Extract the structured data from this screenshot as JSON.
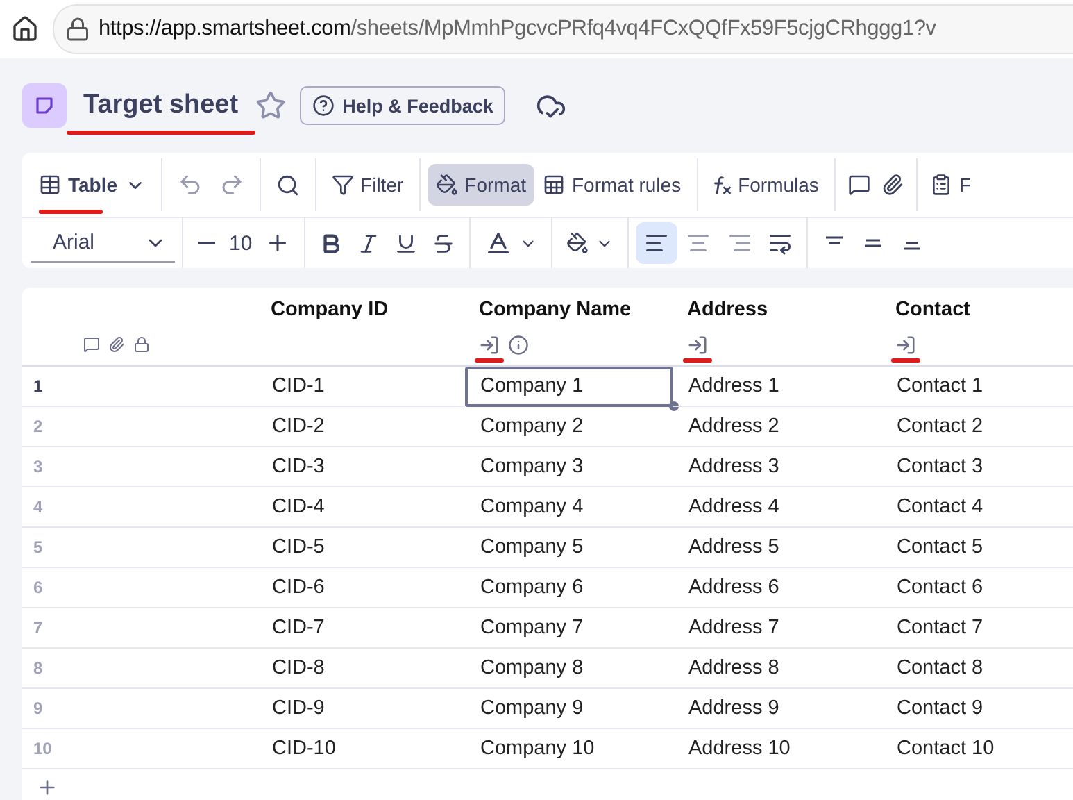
{
  "browser": {
    "url_host": "https://app.smartsheet.com",
    "url_path": "/sheets/MpMmhPgcvcPRfq4vq4FCxQQfFx59F5cjgCRhggg1?v"
  },
  "sheet": {
    "title": "Target sheet",
    "annotated": true,
    "starred": false,
    "help_button": "Help & Feedback"
  },
  "toolbar": {
    "view": {
      "label": "Table",
      "annotated": true
    },
    "filter": "Filter",
    "format": {
      "label": "Format",
      "selected": true
    },
    "format_rules": "Format rules",
    "formulas": "Formulas",
    "cut_off_label": "F"
  },
  "format_bar": {
    "font": "Arial",
    "size": "10",
    "alignment": [
      {
        "kind": "left",
        "selected": true
      },
      {
        "kind": "center",
        "selected": false
      },
      {
        "kind": "right",
        "selected": false
      }
    ]
  },
  "table": {
    "columns": [
      {
        "label": "Company ID",
        "import_icon": false,
        "info_icon": false,
        "annotated": false
      },
      {
        "label": "Company Name",
        "import_icon": true,
        "info_icon": true,
        "annotated": true
      },
      {
        "label": "Address",
        "import_icon": true,
        "info_icon": false,
        "annotated": true
      },
      {
        "label": "Contact",
        "import_icon": true,
        "info_icon": false,
        "annotated": true
      }
    ],
    "rows": [
      {
        "number": "1",
        "selected": true,
        "cells": [
          {
            "text": "CID-1",
            "focused": false
          },
          {
            "text": "Company 1",
            "focused": true
          },
          {
            "text": "Address 1",
            "focused": false
          },
          {
            "text": "Contact 1",
            "focused": false
          }
        ]
      },
      {
        "number": "2",
        "selected": false,
        "cells": [
          {
            "text": "CID-2",
            "focused": false
          },
          {
            "text": "Company 2",
            "focused": false
          },
          {
            "text": "Address 2",
            "focused": false
          },
          {
            "text": "Contact 2",
            "focused": false
          }
        ]
      },
      {
        "number": "3",
        "selected": false,
        "cells": [
          {
            "text": "CID-3",
            "focused": false
          },
          {
            "text": "Company 3",
            "focused": false
          },
          {
            "text": "Address 3",
            "focused": false
          },
          {
            "text": "Contact 3",
            "focused": false
          }
        ]
      },
      {
        "number": "4",
        "selected": false,
        "cells": [
          {
            "text": "CID-4",
            "focused": false
          },
          {
            "text": "Company 4",
            "focused": false
          },
          {
            "text": "Address 4",
            "focused": false
          },
          {
            "text": "Contact 4",
            "focused": false
          }
        ]
      },
      {
        "number": "5",
        "selected": false,
        "cells": [
          {
            "text": "CID-5",
            "focused": false
          },
          {
            "text": "Company 5",
            "focused": false
          },
          {
            "text": "Address 5",
            "focused": false
          },
          {
            "text": "Contact 5",
            "focused": false
          }
        ]
      },
      {
        "number": "6",
        "selected": false,
        "cells": [
          {
            "text": "CID-6",
            "focused": false
          },
          {
            "text": "Company 6",
            "focused": false
          },
          {
            "text": "Address 6",
            "focused": false
          },
          {
            "text": "Contact 6",
            "focused": false
          }
        ]
      },
      {
        "number": "7",
        "selected": false,
        "cells": [
          {
            "text": "CID-7",
            "focused": false
          },
          {
            "text": "Company 7",
            "focused": false
          },
          {
            "text": "Address 7",
            "focused": false
          },
          {
            "text": "Contact 7",
            "focused": false
          }
        ]
      },
      {
        "number": "8",
        "selected": false,
        "cells": [
          {
            "text": "CID-8",
            "focused": false
          },
          {
            "text": "Company 8",
            "focused": false
          },
          {
            "text": "Address 8",
            "focused": false
          },
          {
            "text": "Contact 8",
            "focused": false
          }
        ]
      },
      {
        "number": "9",
        "selected": false,
        "cells": [
          {
            "text": "CID-9",
            "focused": false
          },
          {
            "text": "Company 9",
            "focused": false
          },
          {
            "text": "Address 9",
            "focused": false
          },
          {
            "text": "Contact 9",
            "focused": false
          }
        ]
      },
      {
        "number": "10",
        "selected": false,
        "cells": [
          {
            "text": "CID-10",
            "focused": false
          },
          {
            "text": "Company 10",
            "focused": false
          },
          {
            "text": "Address 10",
            "focused": false
          },
          {
            "text": "Contact 10",
            "focused": false
          }
        ]
      }
    ]
  }
}
